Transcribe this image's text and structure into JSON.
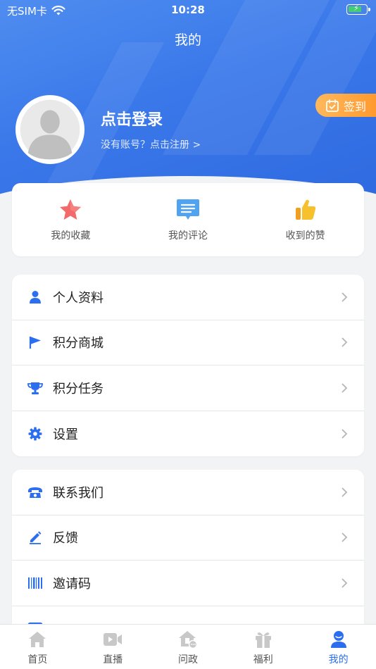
{
  "status": {
    "carrier": "无SIM卡",
    "time": "10:28"
  },
  "header": {
    "title": "我的"
  },
  "profile": {
    "login_text": "点击登录",
    "register_text": "没有账号？点击注册 >",
    "checkin_label": "签到"
  },
  "quick_actions": [
    {
      "label": "我的收藏",
      "icon": "star-icon"
    },
    {
      "label": "我的评论",
      "icon": "comment-icon"
    },
    {
      "label": "收到的赞",
      "icon": "thumbs-up-icon"
    }
  ],
  "menu_group_1": [
    {
      "label": "个人资料",
      "icon": "person-icon"
    },
    {
      "label": "积分商城",
      "icon": "flag-icon"
    },
    {
      "label": "积分任务",
      "icon": "trophy-icon"
    },
    {
      "label": "设置",
      "icon": "gear-icon"
    }
  ],
  "menu_group_2": [
    {
      "label": "联系我们",
      "icon": "telephone-icon"
    },
    {
      "label": "反馈",
      "icon": "pencil-icon"
    },
    {
      "label": "邀请码",
      "icon": "barcode-icon"
    },
    {
      "label": "",
      "icon": "image-icon"
    }
  ],
  "tabbar": [
    {
      "label": "首页",
      "icon": "home-icon",
      "active": false
    },
    {
      "label": "直播",
      "icon": "video-icon",
      "active": false
    },
    {
      "label": "问政",
      "icon": "government-icon",
      "active": false
    },
    {
      "label": "福利",
      "icon": "gift-icon",
      "active": false
    },
    {
      "label": "我的",
      "icon": "profile-icon",
      "active": true
    }
  ],
  "colors": {
    "primary": "#2b6ef0",
    "header": "#3a78ea",
    "checkin": "#ff9a2e",
    "battery": "#43d06b"
  }
}
